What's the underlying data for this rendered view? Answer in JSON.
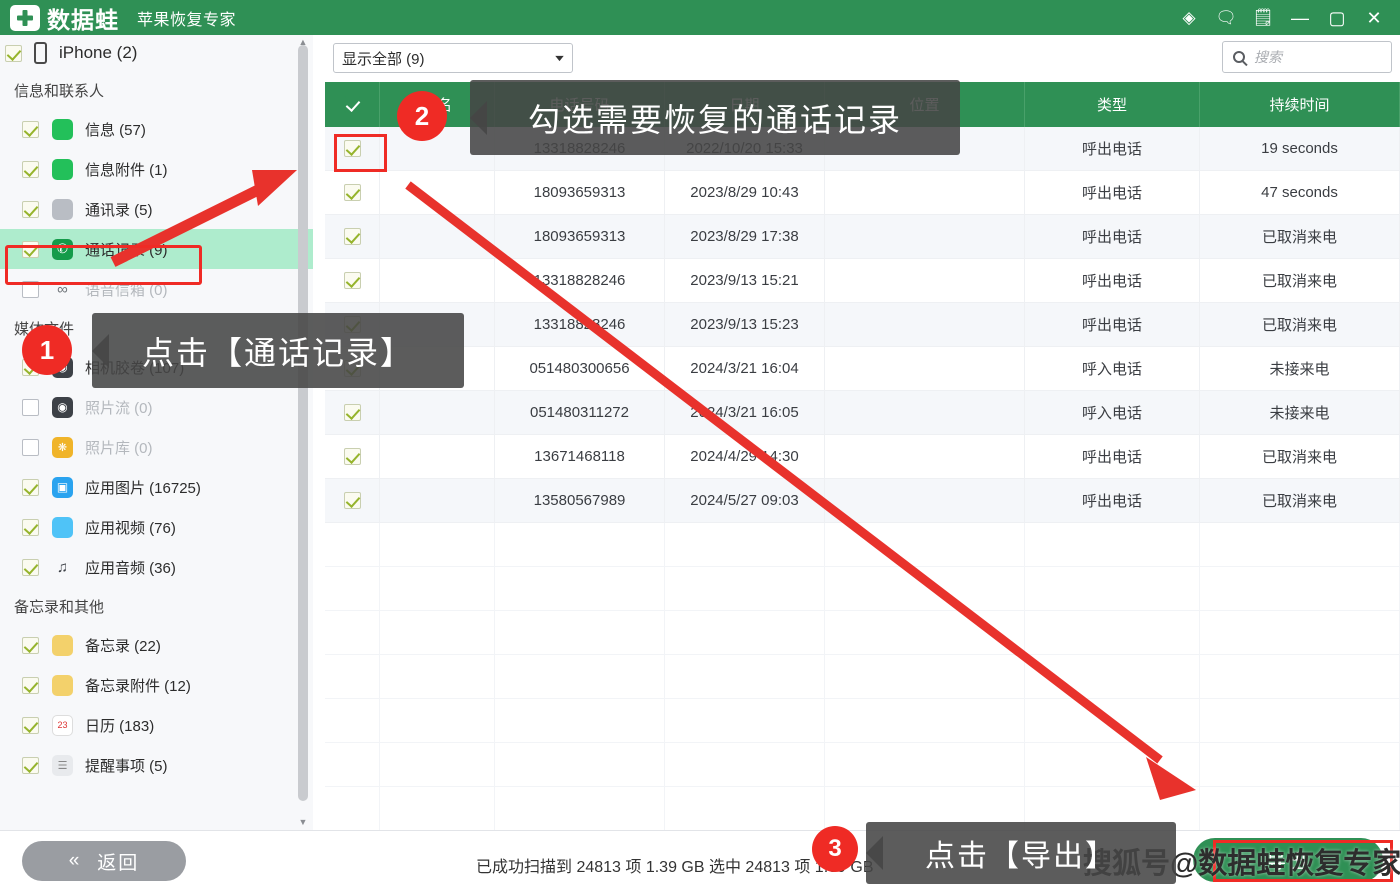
{
  "titlebar": {
    "brand": "数据蛙",
    "product": "苹果恢复专家",
    "icons": [
      {
        "name": "diamond-icon",
        "glyph": "◈"
      },
      {
        "name": "chat-icon",
        "glyph": "🗨"
      },
      {
        "name": "feedback-icon",
        "glyph": "🗒"
      }
    ],
    "minimize": "—",
    "maximize": "▢",
    "close": "✕"
  },
  "sidebar": {
    "device": {
      "label": "iPhone (2)",
      "checked": true
    },
    "groups": [
      {
        "title": "信息和联系人",
        "items": [
          {
            "label": "信息 (57)",
            "checked": true,
            "icon": "message-icon",
            "color": "#23c05a",
            "glyph": "▬"
          },
          {
            "label": "信息附件 (1)",
            "checked": true,
            "icon": "message-attachment-icon",
            "color": "#23c05a",
            "glyph": "▬"
          },
          {
            "label": "通讯录 (5)",
            "checked": true,
            "icon": "contacts-icon",
            "color": "#b9bdc4",
            "glyph": "▤"
          },
          {
            "label": "通话记录 (9)",
            "checked": true,
            "icon": "call-log-icon",
            "color": "#149b4a",
            "glyph": "✆",
            "selected": true
          },
          {
            "label": "语音信箱 (0)",
            "checked": false,
            "icon": "voicemail-icon",
            "color": "#8e9297",
            "glyph": "∞",
            "dim": true
          }
        ]
      },
      {
        "title": "媒体文件",
        "items": [
          {
            "label": "相机胶卷 (107)",
            "checked": true,
            "icon": "camera-roll-icon",
            "color": "#3d4147",
            "glyph": "◉"
          },
          {
            "label": "照片流 (0)",
            "checked": false,
            "icon": "photo-stream-icon",
            "color": "#3d4147",
            "glyph": "◉",
            "dim": true
          },
          {
            "label": "照片库 (0)",
            "checked": false,
            "icon": "photo-library-icon",
            "color": "#f0b429",
            "glyph": "❋",
            "dim": true
          },
          {
            "label": "应用图片 (16725)",
            "checked": true,
            "icon": "app-photos-icon",
            "color": "#2aa3ef",
            "glyph": "▣"
          },
          {
            "label": "应用视频 (76)",
            "checked": true,
            "icon": "app-videos-icon",
            "color": "#4fc3f7",
            "glyph": "▬"
          },
          {
            "label": "应用音频 (36)",
            "checked": true,
            "icon": "app-audio-icon",
            "color": "#ffffff",
            "glyph": "♫"
          }
        ]
      },
      {
        "title": "备忘录和其他",
        "items": [
          {
            "label": "备忘录 (22)",
            "checked": true,
            "icon": "notes-icon",
            "color": "#f3d16b",
            "glyph": "▤"
          },
          {
            "label": "备忘录附件 (12)",
            "checked": true,
            "icon": "notes-attachment-icon",
            "color": "#f3d16b",
            "glyph": "▤"
          },
          {
            "label": "日历 (183)",
            "checked": true,
            "icon": "calendar-icon",
            "color": "#ffffff",
            "glyph": "📅"
          },
          {
            "label": "提醒事项 (5)",
            "checked": true,
            "icon": "reminders-icon",
            "color": "#e8eaed",
            "glyph": "☰"
          }
        ]
      }
    ]
  },
  "toolbar": {
    "filter_value": "显示全部 (9)",
    "filter_caret": "▼",
    "search_placeholder": "搜索",
    "search_value": ""
  },
  "table": {
    "headers": [
      "",
      "姓名",
      "电话号码",
      "日期",
      "位置",
      "类型",
      "持续时间"
    ],
    "header_check": true,
    "rows": [
      {
        "checked": true,
        "name": "",
        "phone": "13318828246",
        "date": "2022/10/20 15:33",
        "location": "",
        "type": "呼出电话",
        "duration": "19 seconds"
      },
      {
        "checked": true,
        "name": "",
        "phone": "18093659313",
        "date": "2023/8/29 10:43",
        "location": "",
        "type": "呼出电话",
        "duration": "47 seconds"
      },
      {
        "checked": true,
        "name": "",
        "phone": "18093659313",
        "date": "2023/8/29 17:38",
        "location": "",
        "type": "呼出电话",
        "duration": "已取消来电"
      },
      {
        "checked": true,
        "name": "",
        "phone": "13318828246",
        "date": "2023/9/13 15:21",
        "location": "",
        "type": "呼出电话",
        "duration": "已取消来电"
      },
      {
        "checked": true,
        "name": "",
        "phone": "13318828246",
        "date": "2023/9/13 15:23",
        "location": "",
        "type": "呼出电话",
        "duration": "已取消来电"
      },
      {
        "checked": true,
        "name": "",
        "phone": "051480300656",
        "date": "2024/3/21 16:04",
        "location": "",
        "type": "呼入电话",
        "duration": "未接来电"
      },
      {
        "checked": true,
        "name": "",
        "phone": "051480311272",
        "date": "2024/3/21 16:05",
        "location": "",
        "type": "呼入电话",
        "duration": "未接来电"
      },
      {
        "checked": true,
        "name": "",
        "phone": "13671468118",
        "date": "2024/4/29 14:30",
        "location": "",
        "type": "呼出电话",
        "duration": "已取消来电"
      },
      {
        "checked": true,
        "name": "",
        "phone": "13580567989",
        "date": "2024/5/27 09:03",
        "location": "",
        "type": "呼出电话",
        "duration": "已取消来电"
      }
    ]
  },
  "bottom": {
    "back_label": "返回",
    "back_chevron": "«",
    "status": "已成功扫描到 24813 项 1.39 GB  选中 24813 项 1.39 GB",
    "export_label": "导出"
  },
  "annotations": {
    "step1": {
      "badge": "1",
      "text": "点击【通话记录】"
    },
    "step2": {
      "badge": "2",
      "text": "勾选需要恢复的通话记录"
    },
    "step3": {
      "badge": "3",
      "text": "点击【导出】"
    }
  },
  "watermark": "搜狐号@数据蛙恢复专家",
  "colors": {
    "brand_green": "#2f9055",
    "accent_red": "#ef2b25",
    "selection_green": "#aeeccd"
  }
}
